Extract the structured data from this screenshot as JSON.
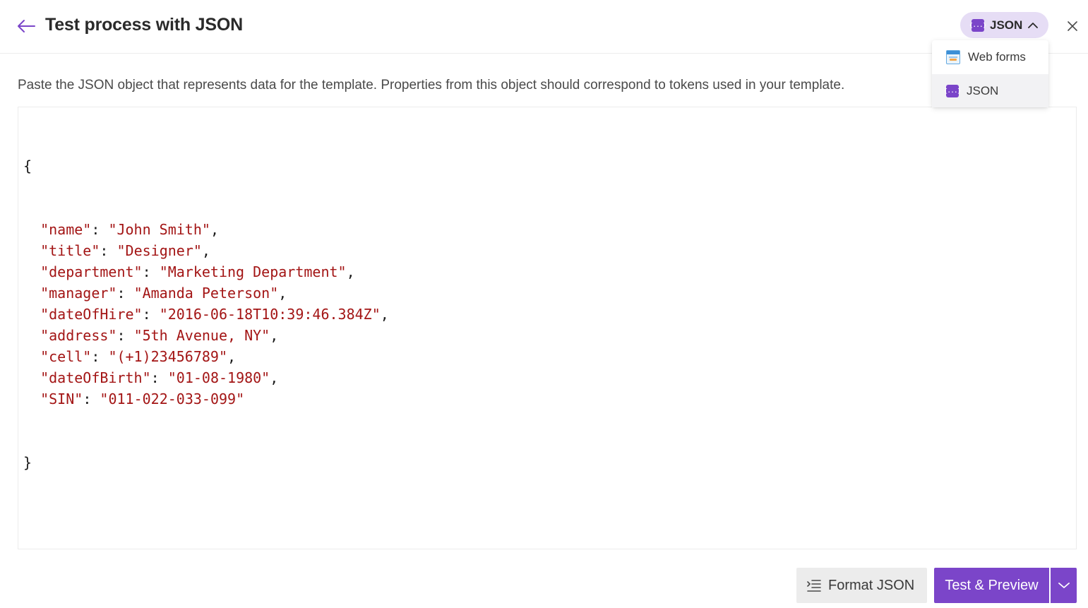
{
  "header": {
    "title": "Test process with JSON",
    "mode": {
      "label": "JSON",
      "badge": "{...}"
    }
  },
  "dropdown": {
    "items": [
      {
        "label": "Web forms",
        "icon": "web-forms-icon"
      },
      {
        "label": "JSON",
        "icon": "json-icon",
        "badge": "{...}",
        "highlighted": true
      }
    ]
  },
  "description": "Paste the JSON object that represents data for the template. Properties from this object should correspond to tokens used in your template.",
  "editor": {
    "open_brace": "{",
    "close_brace": "}",
    "entries": [
      {
        "key": "\"name\"",
        "value": "\"John Smith\"",
        "trail": ","
      },
      {
        "key": "\"title\"",
        "value": "\"Designer\"",
        "trail": ","
      },
      {
        "key": "\"department\"",
        "value": "\"Marketing Department\"",
        "trail": ","
      },
      {
        "key": "\"manager\"",
        "value": "\"Amanda Peterson\"",
        "trail": ","
      },
      {
        "key": "\"dateOfHire\"",
        "value": "\"2016-06-18T10:39:46.384Z\"",
        "trail": ","
      },
      {
        "key": "\"address\"",
        "value": "\"5th Avenue, NY\"",
        "trail": ","
      },
      {
        "key": "\"cell\"",
        "value": "\"(+1)23456789\"",
        "trail": ","
      },
      {
        "key": "\"dateOfBirth\"",
        "value": "\"01-08-1980\"",
        "trail": ","
      },
      {
        "key": "\"SIN\"",
        "value": "\"011-022-033-099\"",
        "trail": ""
      }
    ]
  },
  "footer": {
    "format_label": "Format JSON",
    "test_label": "Test & Preview"
  },
  "colors": {
    "accent": "#7b45c9",
    "toggle_bg": "#e6ddf5",
    "json_string": "#a31515"
  }
}
